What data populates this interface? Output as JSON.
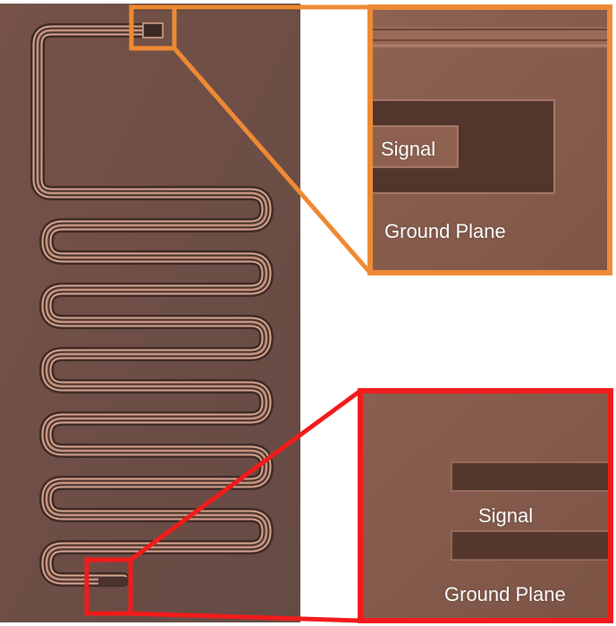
{
  "colors": {
    "substrate": "#6f5047",
    "inset_substrate": "#8a5f4f",
    "trace_edge": "#d9a892",
    "trace_shadow": "#3e2a25",
    "orange_highlight": "#ee8a33",
    "red_highlight": "#f21b1b"
  },
  "insets": {
    "top": {
      "signal_label": "Signal",
      "ground_label": "Ground Plane"
    },
    "bottom": {
      "signal_label": "Signal",
      "ground_label": "Ground Plane"
    }
  }
}
